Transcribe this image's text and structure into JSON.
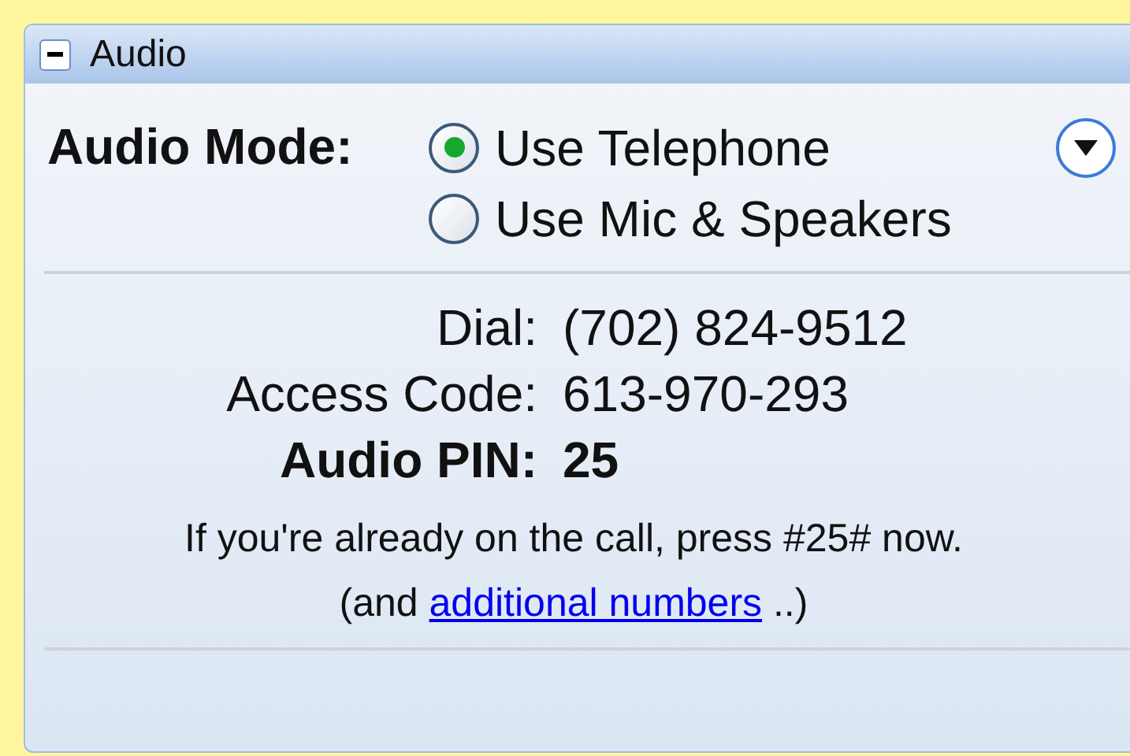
{
  "panel": {
    "title": "Audio",
    "expanded": true
  },
  "audio_mode": {
    "label": "Audio Mode:",
    "options": [
      {
        "label": "Use Telephone",
        "selected": true
      },
      {
        "label": "Use Mic & Speakers",
        "selected": false
      }
    ]
  },
  "details": [
    {
      "label": "Dial:",
      "value": "(702) 824-9512",
      "bold": false
    },
    {
      "label": "Access Code:",
      "value": "613-970-293",
      "bold": false
    },
    {
      "label": "Audio PIN:",
      "value": "25",
      "bold": true
    }
  ],
  "note": "If you're already on the call, press #25# now.",
  "more": {
    "prefix": "(and ",
    "link": "additional numbers",
    "suffix": " ..)"
  }
}
